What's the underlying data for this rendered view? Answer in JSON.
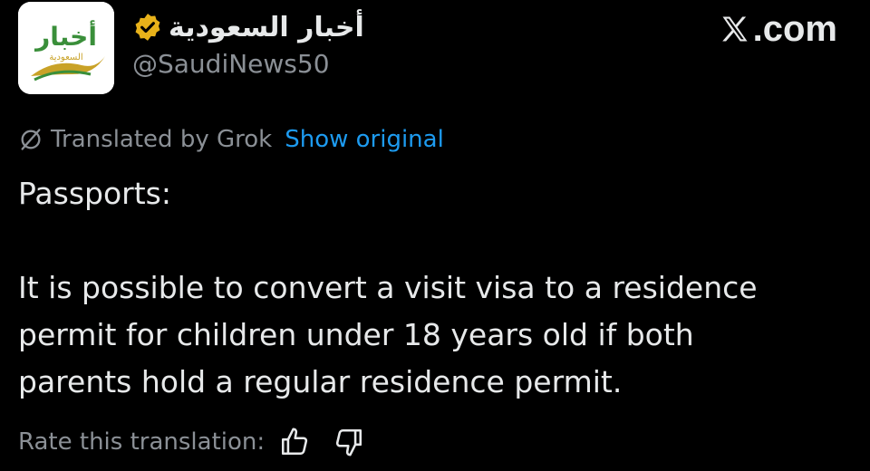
{
  "account": {
    "display_name": "أخبار السعودية",
    "handle": "@SaudiNews50",
    "avatar_text": "أخبار",
    "avatar_subtext": "السعودية",
    "verified": true,
    "verified_color": "#e8b21a"
  },
  "brand": {
    "text": ".com",
    "icon": "x-logo-icon"
  },
  "translation": {
    "icon": "grok-icon",
    "label": "Translated by Grok",
    "show_original_label": "Show original",
    "link_color": "#1d9bf0"
  },
  "tweet": {
    "title": "Passports:",
    "body_lines": [
      "It is possible to convert a visit visa to a residence",
      "permit for children under 18 years old if both",
      "parents hold a regular residence permit."
    ]
  },
  "rating": {
    "label": "Rate this translation:",
    "thumbs_up_icon": "thumbs-up-icon",
    "thumbs_down_icon": "thumbs-down-icon"
  },
  "colors": {
    "background": "#000000",
    "primary_text": "#e7e9ea",
    "secondary_text": "#8b9096",
    "accent_green": "#3a8f3a",
    "accent_gold": "#c9a227"
  }
}
